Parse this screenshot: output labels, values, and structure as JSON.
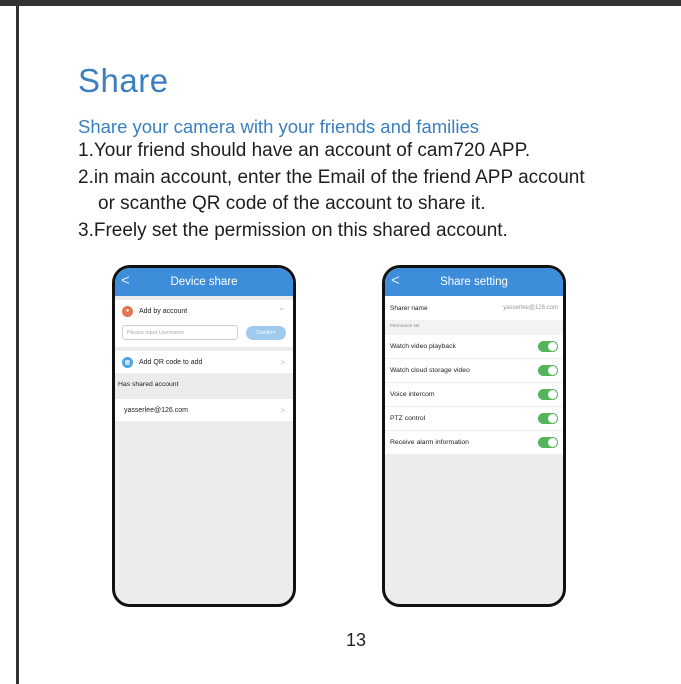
{
  "heading": {
    "title": "Share",
    "subtitle": "Share your camera with your friends and families",
    "steps": [
      "1.Your friend should have an account of cam720 APP.",
      "2.in main account, enter the Email of the friend APP account",
      "or scanthe QR code of the account to share it.",
      "3.Freely set the permission on this shared account."
    ]
  },
  "device_share": {
    "title": "Device share",
    "back_icon": "<",
    "add_by_account": "Add by account",
    "input_placeholder": "Please input Username",
    "confirm": "Confirm",
    "add_qr": "Add QR code to add",
    "shared_caption": "Has shared account",
    "shared_items": [
      "yasserlee@126.com"
    ]
  },
  "share_setting": {
    "title": "Share setting",
    "back_icon": "<",
    "sharer_label": "Sharer name",
    "sharer_value": "yasserlee@126.com",
    "permission_caption": "Permission set",
    "permissions": [
      "Watch video playback",
      "Watch cloud storage video",
      "Voice intercom",
      "PTZ control",
      "Receive alarm information"
    ]
  },
  "page_number": "13",
  "colors": {
    "accent": "#3a7fc0",
    "app_bar": "#3d8ddb",
    "toggle_on": "#55b35c"
  }
}
